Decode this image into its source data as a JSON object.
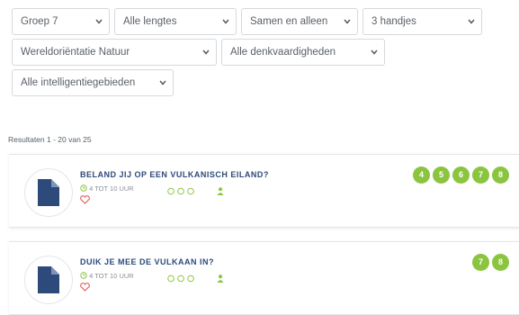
{
  "filters": {
    "group": "Groep 7",
    "length": "Alle lengtes",
    "collaboration": "Samen en alleen",
    "hands": "3 handjes",
    "world": "Wereldoriëntatie  Natuur",
    "thinking": "Alle denkvaardigheden",
    "intelligence": "Alle intelligentiegebieden"
  },
  "results": {
    "summary": "Resultaten 1 - 20 van 25"
  },
  "cards": [
    {
      "title": "BELAND JIJ OP EEN VULKANISCH EILAND?",
      "duration": "4 TOT 10 UUR",
      "badges": [
        "4",
        "5",
        "6",
        "7",
        "8"
      ]
    },
    {
      "title": "DUIK JE MEE DE VULKAAN IN?",
      "duration": "4 TOT 10 UUR",
      "badges": [
        "7",
        "8"
      ]
    }
  ],
  "colors": {
    "accent_green": "#8bc53f",
    "title_blue": "#2d4a7a",
    "heart_red": "#e25a5a",
    "doc_blue": "#2d4a7a"
  },
  "icons": [
    "chevron-down-icon",
    "document-icon",
    "clock-icon",
    "heart-icon",
    "hands-icon",
    "person-icon"
  ]
}
